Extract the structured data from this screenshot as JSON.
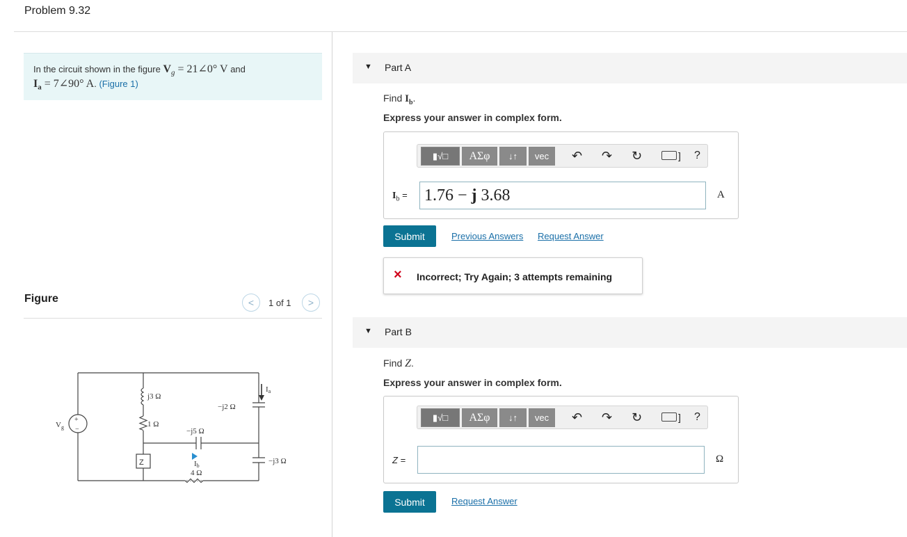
{
  "problem": {
    "title": "Problem 9.32",
    "statement_prefix": "In the circuit shown in the figure ",
    "vg_symbol": "V",
    "vg_sub": "g",
    "vg_value": " = 21∠0° V",
    "and_text": " and",
    "ia_symbol": "I",
    "ia_sub": "a",
    "ia_value": " = 7∠90° A",
    "period": ". ",
    "figure_link": "(Figure 1)"
  },
  "figure": {
    "label": "Figure",
    "pager_text": "1 of 1",
    "prev_icon": "chevron-left-icon",
    "next_icon": "chevron-right-icon",
    "circuit": {
      "source_label": "V",
      "source_sub": "g",
      "plus": "+",
      "minus": "−",
      "j3": "j3 Ω",
      "r1": "1 Ω",
      "z": "Z",
      "neg_j5": "−j5 Ω",
      "ib_label": "I",
      "ib_sub": "b",
      "r4": "4 Ω",
      "neg_j2": "−j2 Ω",
      "ia_label": "I",
      "ia_sub": "a",
      "neg_j3": "−j3 Ω"
    }
  },
  "toolbar": {
    "template_btn": "▮√□",
    "symbols_btn": "ΑΣφ",
    "updown_btn": "↓↑",
    "vec_btn": "vec",
    "undo": "↶",
    "redo": "↷",
    "reset": "↻",
    "keyboard_suffix": "]",
    "help": "?"
  },
  "partA": {
    "title": "Part A",
    "find_prefix": "Find ",
    "find_var": "I",
    "find_sub": "b",
    "find_suffix": ".",
    "instruction": "Express your answer in complex form.",
    "answer_label_var": "I",
    "answer_label_sub": "b",
    "answer_label_eq": " =",
    "answer_value_real": "1.76 − ",
    "answer_value_j": "j",
    "answer_value_imag": " 3.68",
    "unit": "A",
    "submit": "Submit",
    "previous_answers": "Previous Answers",
    "request_answer": "Request Answer",
    "feedback_icon": "×",
    "feedback": "Incorrect; Try Again; 3 attempts remaining"
  },
  "partB": {
    "title": "Part B",
    "find_prefix": "Find ",
    "find_var": "Z",
    "find_suffix": ".",
    "instruction": "Express your answer in complex form.",
    "answer_label": "Z =",
    "answer_value": "",
    "unit": "Ω",
    "submit": "Submit",
    "request_answer": "Request Answer"
  }
}
